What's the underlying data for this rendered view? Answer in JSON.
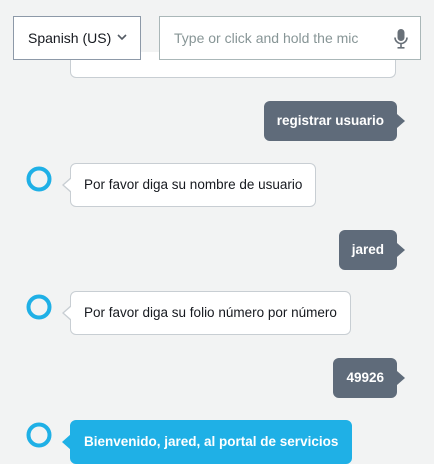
{
  "controls": {
    "language_selected": "Spanish (US)",
    "input_placeholder": "Type or click and hold the mic"
  },
  "conversation": [
    {
      "sender": "user",
      "text": "registrar usuario"
    },
    {
      "sender": "bot",
      "text": "Por favor diga su nombre de usuario"
    },
    {
      "sender": "user",
      "text": "jared"
    },
    {
      "sender": "bot",
      "text": "Por favor diga su folio número por número"
    },
    {
      "sender": "user",
      "text": "49926"
    },
    {
      "sender": "bot",
      "text": "Bienvenido, jared, al portal de servicios"
    }
  ],
  "colors": {
    "background": "#f2f3f3",
    "user_bubble": "#5f6b7a",
    "bot_bubble": "#ffffff",
    "final_bot_bubble": "#1fb0e6",
    "avatar_ring": "#1fb0e6"
  },
  "icons": {
    "dropdown": "chevron-down-icon",
    "microphone": "mic-icon",
    "bot_avatar": "alexa-ring-icon"
  }
}
